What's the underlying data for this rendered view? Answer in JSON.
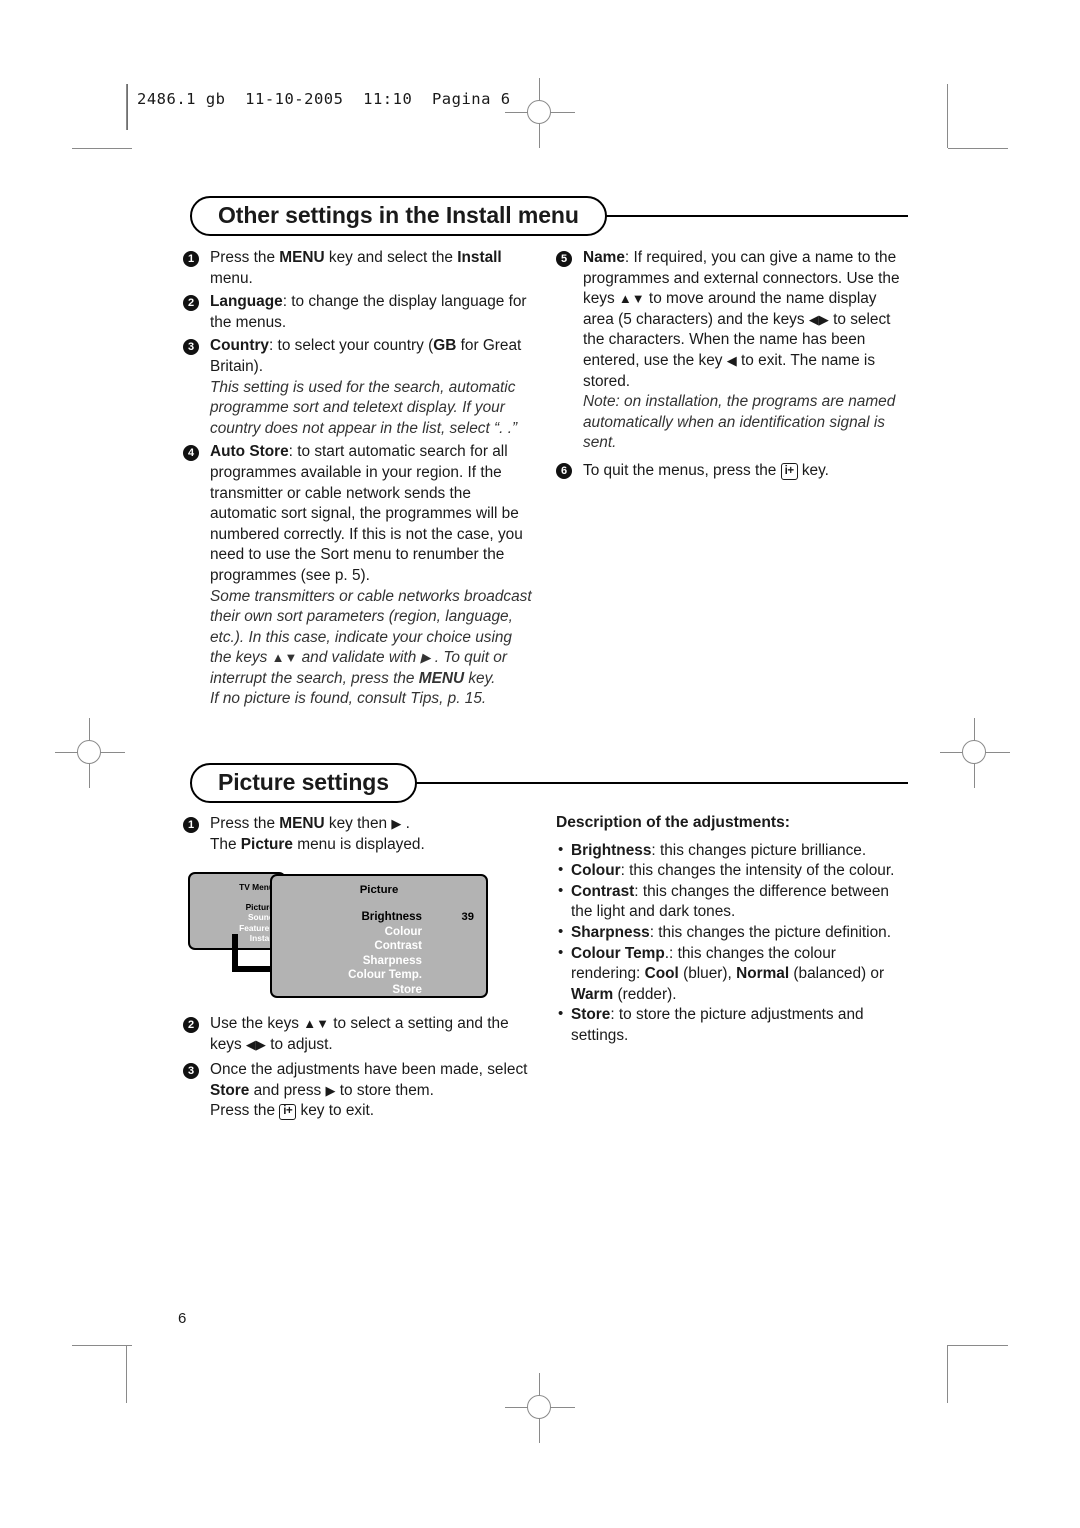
{
  "print_slug": "2486.1 gb  11-10-2005  11:10  Pagina 6",
  "page_number": "6",
  "sections": {
    "install": {
      "heading": "Other settings in the Install menu",
      "left_items": [
        {
          "num": "1",
          "html": "Press the <b>MENU</b> key and select the <b>Install</b> menu."
        },
        {
          "num": "2",
          "html": "<b>Language</b>: to change the display language for the menus."
        },
        {
          "num": "3",
          "html": "<b>Country</b>: to select your country (<b>GB</b> for Great Britain).<br><span class=\"note\">This setting is used for the search, automatic programme sort and teletext display. If your country does not appear in the list, select “. .”</span>"
        },
        {
          "num": "4",
          "html": "<b>Auto Store</b>: to start automatic search for all programmes available in your region. If the transmitter or cable network sends the automatic sort signal, the programmes will be numbered correctly. If this is not the case, you need to use the Sort menu to renumber the programmes (see p. 5).<br><span class=\"note\">Some transmitters or cable networks broadcast their own sort parameters (region, language, etc.). In this case, indicate your choice using the keys <span class=\"arw\">▲▼</span> and validate with <span class=\"arw\">▶</span> . To quit or interrupt the search, press the <b>MENU</b> key.<br>If no picture is found, consult Tips, p. 15.</span>"
        }
      ],
      "right_items": [
        {
          "num": "5",
          "html": "<b>Name</b>: If required, you can give a name to the programmes and external connectors. Use the keys <span class=\"arw\">▲▼</span> to move around the name display area (5 characters) and the keys <span class=\"arw\">◀▶</span> to select the characters. When the name has been entered, use the key <span class=\"arw\">◀</span> to exit. The name is stored.<br><span class=\"note\">Note: on installation, the programs are named automatically when an identification signal is sent.</span>"
        },
        {
          "num": "6",
          "html": "To quit the menus, press the <span class=\"ikey\">i+</span> key."
        }
      ]
    },
    "picture": {
      "heading": "Picture settings",
      "left_items": [
        {
          "num": "1",
          "html": "Press the <b>MENU</b> key then <span class=\"arw\">▶</span> .<br>The <b>Picture</b> menu is displayed."
        }
      ],
      "left_items_after": [
        {
          "num": "2",
          "html": "Use the keys <span class=\"arw\">▲▼</span> to select a setting and the keys <span class=\"arw\">◀▶</span> to adjust."
        },
        {
          "num": "3",
          "html": "Once the adjustments have been made, select <b>Store</b> and press <span class=\"arw\">▶</span> to store them.<br>Press the <span class=\"ikey\">i+</span> key to exit."
        }
      ],
      "description_title": "Description of the adjustments:",
      "bullets": [
        {
          "html": "<b>Brightness</b>: this changes picture brilliance."
        },
        {
          "html": "<b>Colour</b>: this changes the intensity of the colour."
        },
        {
          "html": "<b>Contrast</b>: this changes the difference between the light and dark tones."
        },
        {
          "html": "<b>Sharpness</b>: this changes the picture definition."
        },
        {
          "html": "<b>Colour Temp</b>.: this changes the colour rendering: <b>Cool</b> (bluer), <b>Normal</b> (balanced) or <b>Warm</b> (redder)."
        },
        {
          "html": "<b>Store</b>: to store the picture adjustments and settings."
        }
      ]
    }
  },
  "tv_menu_figure": {
    "left_panel": {
      "header": "TV Menu",
      "items": [
        {
          "label": "Picture",
          "selected": true
        },
        {
          "label": "Sound",
          "selected": false
        },
        {
          "label": "Features",
          "selected": false
        },
        {
          "label": "Install",
          "selected": false
        }
      ]
    },
    "right_panel": {
      "title": "Picture",
      "rows": [
        {
          "label": "Brightness",
          "value": "39",
          "selected": true
        },
        {
          "label": "Colour",
          "value": "",
          "selected": false
        },
        {
          "label": "Contrast",
          "value": "",
          "selected": false
        },
        {
          "label": "Sharpness",
          "value": "",
          "selected": false
        },
        {
          "label": "Colour Temp.",
          "value": "",
          "selected": false
        },
        {
          "label": "Store",
          "value": "",
          "selected": false
        }
      ]
    },
    "colors": {
      "panel_background": "#b3b3b3",
      "selected_text": "#000000",
      "option_text": "#ffffff"
    }
  }
}
